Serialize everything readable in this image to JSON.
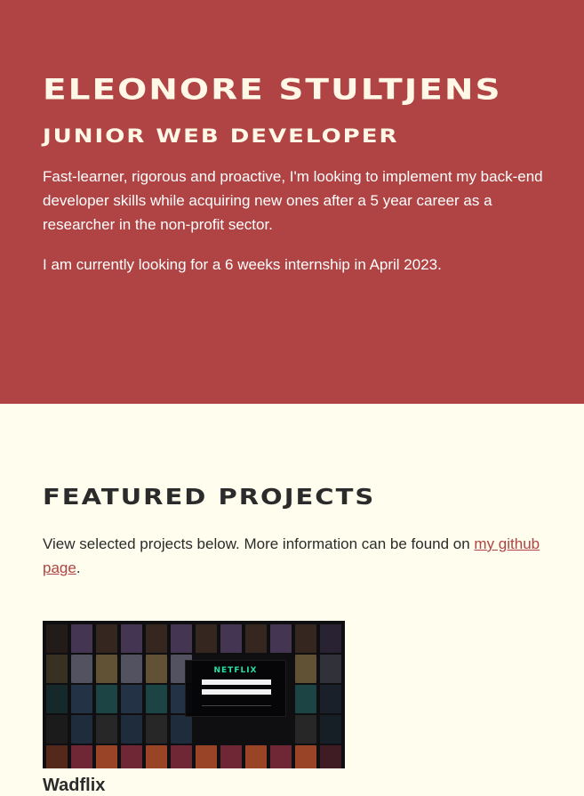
{
  "hero": {
    "name": "Eleonore Stultjens",
    "role": "Junior Web Developer",
    "bio": "Fast-learner, rigorous and proactive, I'm looking to implement my back-end developer skills while acquiring new ones after a 5 year career as a researcher in the non-profit sector.",
    "status": "I am currently looking for a 6 weeks internship in April 2023."
  },
  "projects": {
    "heading": "Featured Projects",
    "intro_before": "View selected projects below. More information can be found on ",
    "link_label": "my github page",
    "intro_after": ".",
    "items": [
      {
        "title": "Wadflix",
        "thumb_logo": "NETFLIX"
      }
    ]
  },
  "colors": {
    "hero_bg": "#b04343",
    "page_bg": "#fffeee",
    "accent": "#b04343",
    "thumb_logo": "#26e0a0"
  }
}
